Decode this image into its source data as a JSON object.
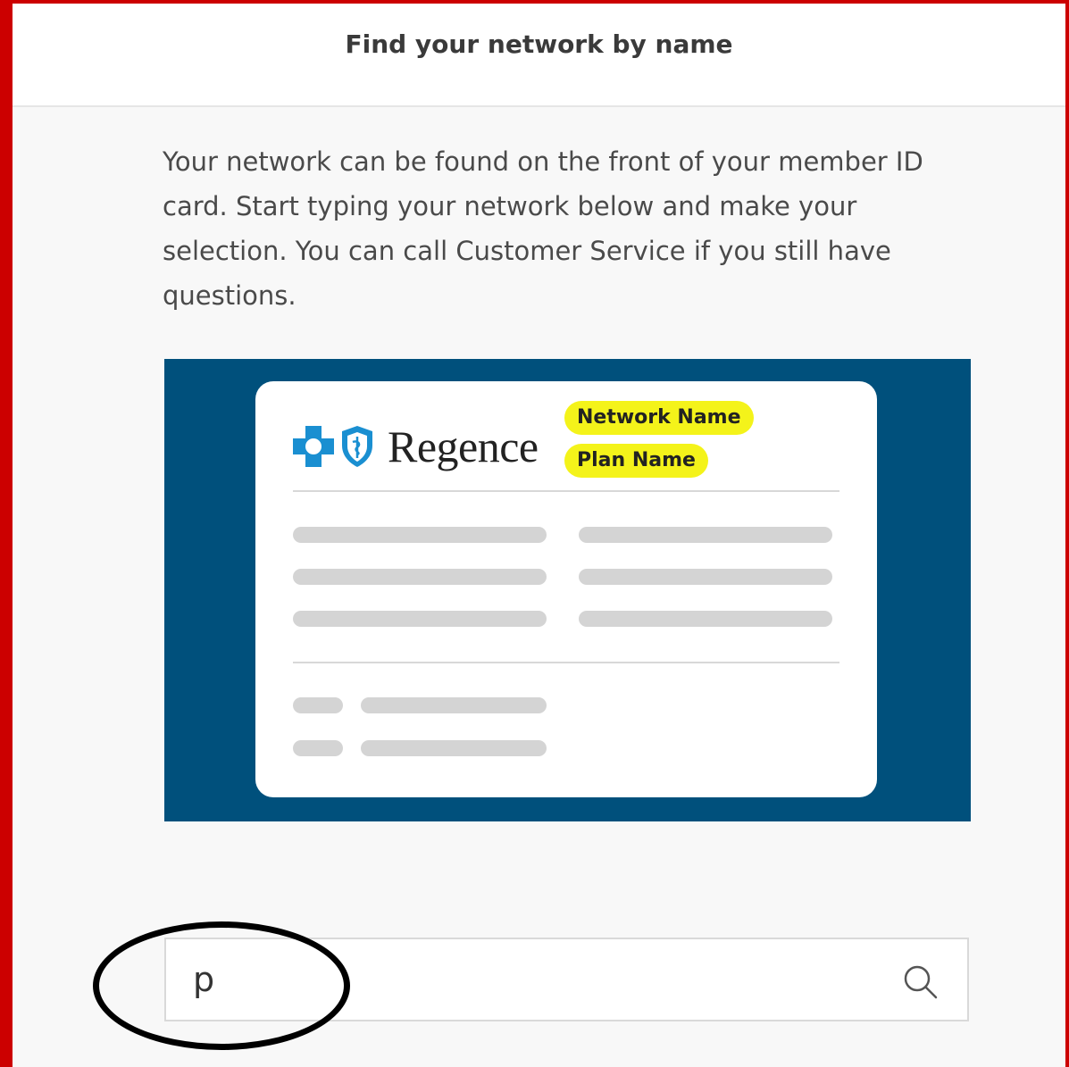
{
  "header": {
    "title": "Find your network by name"
  },
  "intro": {
    "text": "Your network can be found on the front of your member ID card. Start typing your network below and make your selection. You can call Customer Service if you still have questions."
  },
  "card_illustration": {
    "brand": "Regence",
    "labels": {
      "network": "Network Name",
      "plan": "Plan Name"
    },
    "colors": {
      "background": "#00507c",
      "highlight": "#f4f31a",
      "logo": "#1a8fd1"
    }
  },
  "search": {
    "value": "p",
    "icon": "search-icon"
  },
  "annotation": {
    "shape": "ellipse",
    "target": "search-input"
  }
}
